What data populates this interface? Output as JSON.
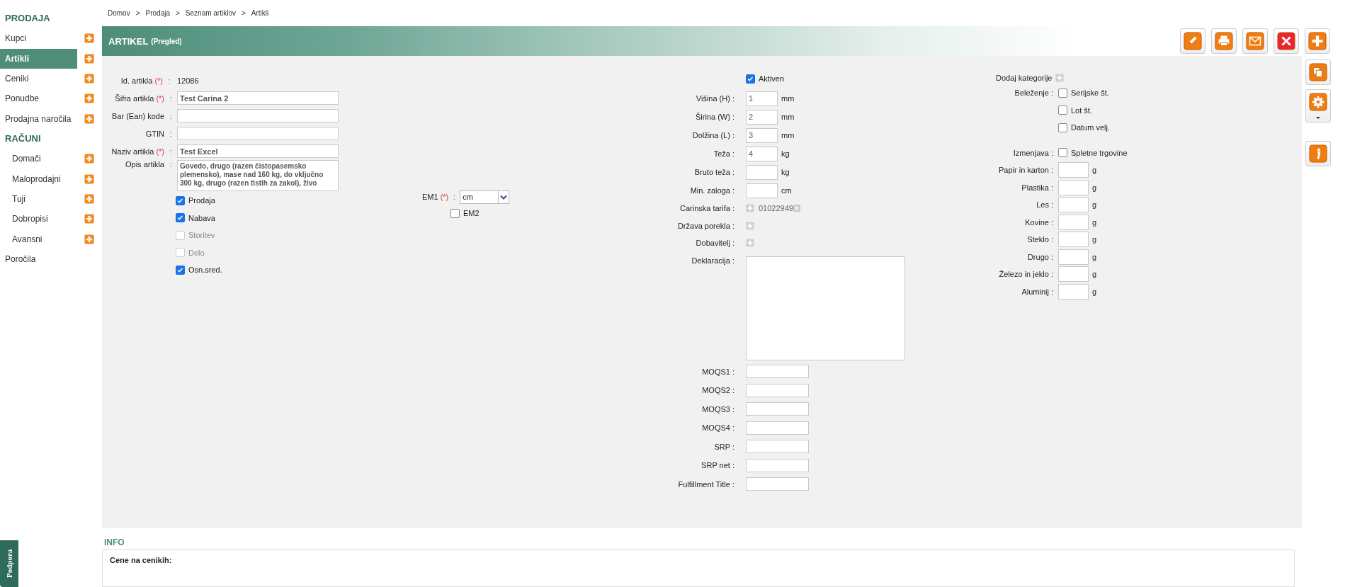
{
  "sidebar": {
    "items": [
      {
        "kind": "heading",
        "label": "PRODAJA"
      },
      {
        "kind": "link",
        "label": "Kupci",
        "selected": false,
        "add": true
      },
      {
        "kind": "link",
        "label": "Artikli",
        "selected": true,
        "add": true
      },
      {
        "kind": "link",
        "label": "Ceniki",
        "selected": false,
        "add": true
      },
      {
        "kind": "link",
        "label": "Ponudbe",
        "selected": false,
        "add": true
      },
      {
        "kind": "link",
        "label": "Prodajna naročila",
        "selected": false,
        "add": true
      },
      {
        "kind": "heading",
        "label": "RAČUNI",
        "children": [
          {
            "label": "Domači",
            "selected": false,
            "add": true
          },
          {
            "label": "Maloprodajni",
            "selected": false,
            "add": true
          },
          {
            "label": "Tuji",
            "selected": false,
            "add": true
          },
          {
            "label": "Dobropisi",
            "selected": false,
            "add": true
          },
          {
            "label": "Avansni",
            "selected": false,
            "add": true
          }
        ]
      },
      {
        "kind": "link",
        "label": "Poročila",
        "selected": false,
        "add": false
      }
    ]
  },
  "breadcrumb": [
    {
      "label": "Domov",
      "separator": ">"
    },
    {
      "label": "Prodaja",
      "separator": ">"
    },
    {
      "label": "Seznam artiklov",
      "separator": ">"
    },
    {
      "label": "Artikli"
    }
  ],
  "header": {
    "title": "ARTIKEL",
    "subtitle": "(Pregled)"
  },
  "toolbar": [
    {
      "kind": "edit"
    },
    {
      "kind": "print"
    },
    {
      "kind": "email"
    },
    {
      "kind": "delete"
    },
    {
      "kind": "add"
    }
  ],
  "side_tools": [
    {
      "kind": "copy",
      "dropdown": false
    },
    {
      "kind": "settings",
      "dropdown": true
    },
    {
      "kind": "info",
      "dropdown": false
    }
  ],
  "form": {
    "left": {
      "fields": [
        {
          "kind": "static",
          "label": "Id. artikla",
          "required": "(*)",
          "sep": ":",
          "value": "12086"
        },
        {
          "kind": "input",
          "label": "Šifra artikla",
          "required": "(*)",
          "sep": ":",
          "value": "Test Carina 2"
        },
        {
          "kind": "input",
          "label": "Bar (Ean) kode",
          "sep": ":"
        },
        {
          "kind": "input",
          "label": "GTIN",
          "sep": ":"
        },
        {
          "kind": "input",
          "label": "Naziv artikla",
          "required": "(*)",
          "sep": ":",
          "value": "Test Excel"
        },
        {
          "kind": "textarea",
          "label": "Opis artikla",
          "sep": ":",
          "value": "Govedo, drugo (razen čistopasemsko plemensko), mase nad 160 kg, do vključno 300 kg, drugo (razen tistih za zakol), živo"
        }
      ],
      "checks": [
        {
          "label": "Prodaja",
          "checked": true,
          "disabled": false
        },
        {
          "label": "Nabava",
          "checked": true,
          "disabled": false
        },
        {
          "label": "Storitev",
          "checked": false,
          "disabled": true
        },
        {
          "label": "Delo",
          "checked": false,
          "disabled": true
        },
        {
          "label": "Osn.sred.",
          "checked": true,
          "disabled": false
        }
      ]
    },
    "unit": {
      "label": "EM1",
      "required": "(*)",
      "sep": ":",
      "value": "cm",
      "second": {
        "label": "EM2",
        "checked": false
      }
    },
    "middle": {
      "active": {
        "label": "Aktiven",
        "checked": true
      },
      "rows": [
        {
          "kind": "input",
          "label": "Višina (H) :",
          "value": "1",
          "unit": "mm"
        },
        {
          "kind": "input",
          "label": "Širina (W) :",
          "value": "2",
          "unit": "mm"
        },
        {
          "kind": "input",
          "label": "Dolžina (L) :",
          "value": "3",
          "unit": "mm"
        },
        {
          "kind": "input",
          "label": "Teža :",
          "value": "4",
          "unit": "kg"
        },
        {
          "kind": "input",
          "label": "Bruto teža :",
          "unit": "kg"
        },
        {
          "kind": "input",
          "label": "Min. zaloga :",
          "unit": "cm"
        },
        {
          "kind": "picker",
          "label": "Carinska tarifa :",
          "value": "01022949",
          "removable": true
        },
        {
          "kind": "picker",
          "label": "Država porekla :",
          "removable": false
        },
        {
          "kind": "picker",
          "label": "Dobavitelj :",
          "removable": false
        },
        {
          "kind": "textarea",
          "label": "Deklaracija :"
        },
        {
          "kind": "wide",
          "label": "MOQS1 :"
        },
        {
          "kind": "wide",
          "label": "MOQS2 :"
        },
        {
          "kind": "wide",
          "label": "MOQS3 :"
        },
        {
          "kind": "wide",
          "label": "MOQS4 :"
        },
        {
          "kind": "wide",
          "label": "SRP :"
        },
        {
          "kind": "wide",
          "label": "SRP net :"
        },
        {
          "kind": "wide",
          "label": "Fulfillment Title :"
        }
      ]
    },
    "right": {
      "add_category": "Dodaj kategorije",
      "tracking": {
        "label": "Beleženje :",
        "options": [
          {
            "label": "Serijske št.",
            "checked": false
          },
          {
            "label": "Lot št.",
            "checked": false
          },
          {
            "label": "Datum velj.",
            "checked": false
          }
        ]
      },
      "change": {
        "label": "Izmenjava :",
        "options": [
          {
            "label": "Spletne trgovine",
            "checked": false
          }
        ]
      },
      "packaging": [
        {
          "label": "Papir in karton :",
          "unit": "g"
        },
        {
          "label": "Plastika :",
          "unit": "g"
        },
        {
          "label": "Les :",
          "unit": "g"
        },
        {
          "label": "Kovine :",
          "unit": "g"
        },
        {
          "label": "Steklo :",
          "unit": "g"
        },
        {
          "label": "Drugo :",
          "unit": "g"
        },
        {
          "label": "Železo in jeklo :",
          "unit": "g"
        },
        {
          "label": "Aluminij :",
          "unit": "g"
        }
      ]
    }
  },
  "info": {
    "title": "INFO",
    "heading": "Cene na cenikih:"
  },
  "support_tab": {
    "label": "Podpora"
  }
}
